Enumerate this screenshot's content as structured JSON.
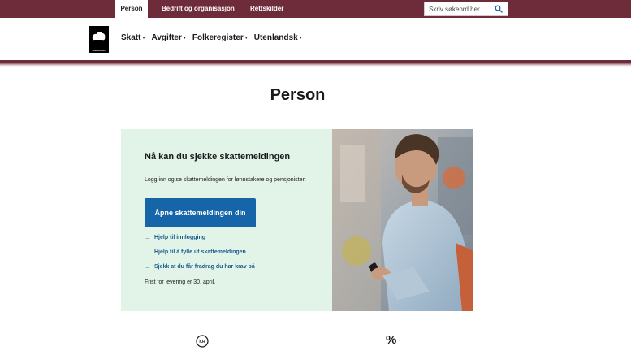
{
  "topbar": {
    "tabs": [
      {
        "label": "Person",
        "active": true
      },
      {
        "label": "Bedrift og organisasjon",
        "active": false
      },
      {
        "label": "Rettskilder",
        "active": false
      }
    ],
    "search_placeholder": "Skriv søkeord her",
    "search_icon": "search-icon"
  },
  "header": {
    "logo_text": "Skatteetaten",
    "nav": [
      {
        "label": "Skatt"
      },
      {
        "label": "Avgifter"
      },
      {
        "label": "Folkeregister"
      },
      {
        "label": "Utenlandsk"
      }
    ]
  },
  "main": {
    "title": "Person",
    "promo": {
      "heading": "Nå kan du sjekke skattemeldingen",
      "description": "Logg inn og se skattemeldingen for lønnstakere og pensjonister:",
      "cta_label": "Åpne skattemeldingen din",
      "links": [
        {
          "label": "Hjelp til innlogging"
        },
        {
          "label": "Hjelp til å fylle ut skattemeldingen"
        },
        {
          "label": "Sjekk at du får fradrag du har krav på"
        }
      ],
      "deadline": "Frist for levering er 30. april."
    },
    "icons": {
      "kr_label": "KR",
      "percent_label": "%"
    }
  },
  "colors": {
    "brand": "#6e2b3a",
    "promo_bg": "#e2f3e8",
    "button": "#1565a8",
    "link": "#1a5e8e"
  }
}
